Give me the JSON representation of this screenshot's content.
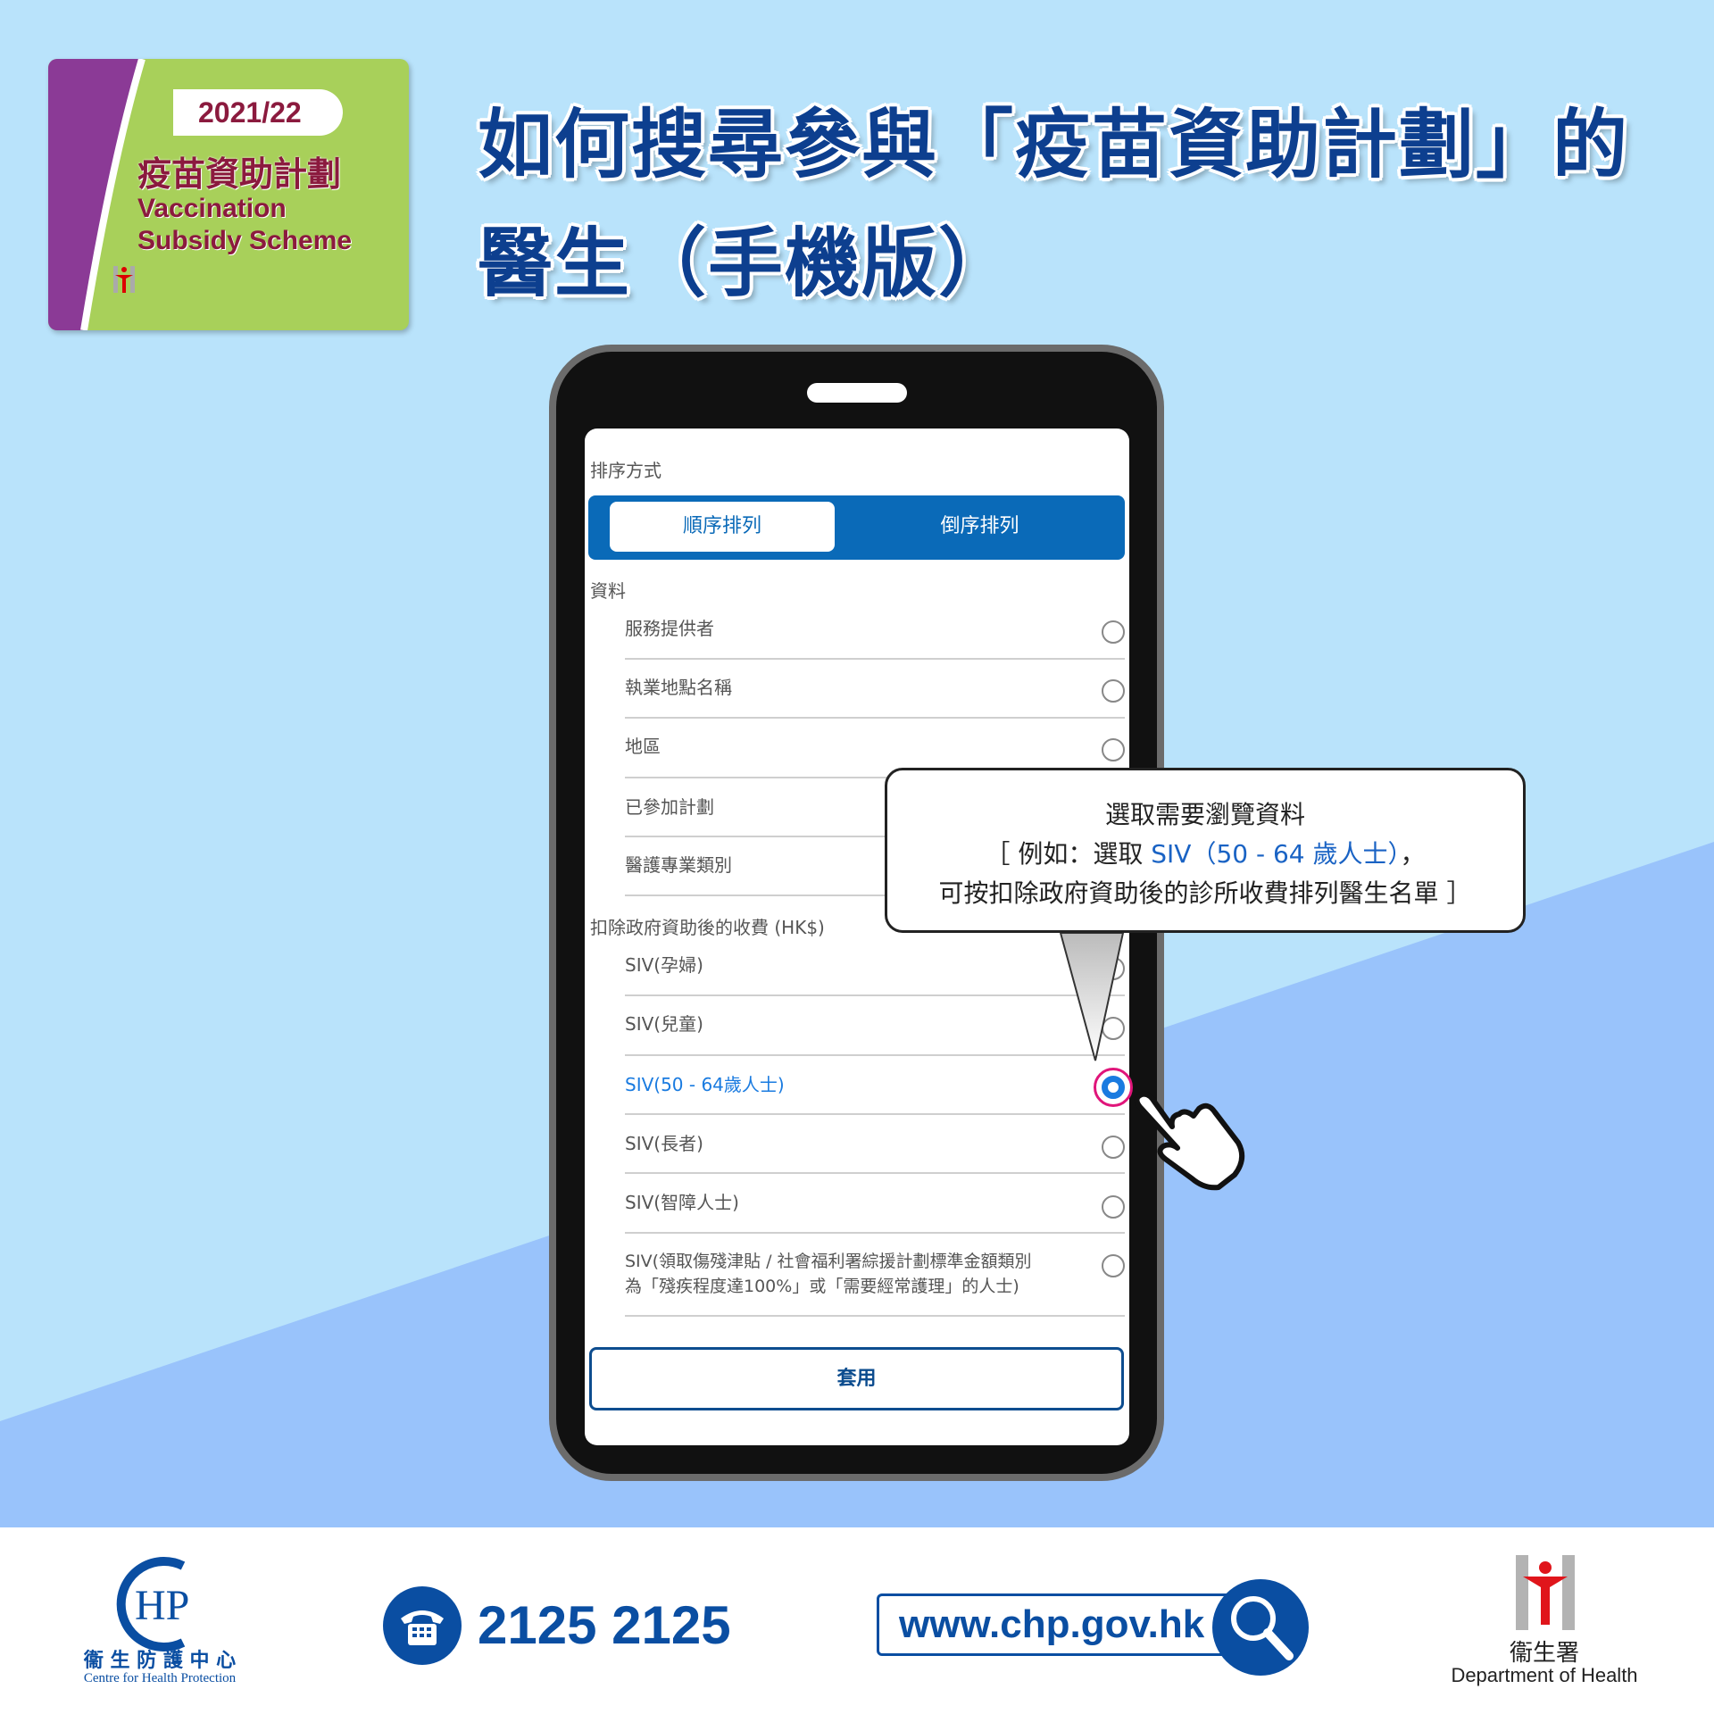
{
  "badge": {
    "year": "2021/22",
    "title_zh": "疫苗資助計劃",
    "title_en_1": "Vaccination",
    "title_en_2": "Subsidy Scheme",
    "logo_text": "衞生署 Department of Health"
  },
  "title": {
    "line1": "如何搜尋參與「疫苗資助計劃」的",
    "line2": "醫生（手機版）"
  },
  "screen": {
    "sort_label": "排序方式",
    "sort_options": [
      {
        "label": "順序排列",
        "selected": true
      },
      {
        "label": "倒序排列",
        "selected": false
      }
    ],
    "info_label": "資料",
    "info_items": [
      {
        "label": "服務提供者"
      },
      {
        "label": "執業地點名稱"
      },
      {
        "label": "地區"
      },
      {
        "label": "已參加計劃"
      },
      {
        "label": "醫護專業類別"
      }
    ],
    "fee_label": "扣除政府資助後的收費 (HK$)",
    "fee_items": [
      {
        "label": "SIV(孕婦)",
        "selected": false
      },
      {
        "label": "SIV(兒童)",
        "selected": false
      },
      {
        "label": "SIV(50 - 64歲人士)",
        "selected": true
      },
      {
        "label": "SIV(長者)",
        "selected": false
      },
      {
        "label": "SIV(智障人士)",
        "selected": false
      },
      {
        "label": "SIV(領取傷殘津貼 / 社會福利署綜援計劃標準金額類別",
        "label2": "為「殘疾程度達100%」或「需要經常護理」的人士)",
        "selected": false
      }
    ],
    "apply_label": "套用"
  },
  "callout": {
    "line1": "選取需要瀏覽資料",
    "line2_a": "［ 例如：選取 ",
    "line2_b": "SIV（50 - 64 歲人士）",
    "line2_c": "，",
    "line3": "可按扣除政府資助後的診所收費排列醫生名單 ］"
  },
  "footer": {
    "chp_logo": "CHP",
    "chp_zh": "衞 生 防 護 中 心",
    "chp_en": "Centre for Health Protection",
    "phone": "2125 2125",
    "url": "www.chp.gov.hk",
    "doh_zh": "衞生署",
    "doh_en": "Department of Health"
  },
  "colors": {
    "accent": "#0a6ab8",
    "title": "#0d3f8f",
    "badge_green": "#a8d05a",
    "badge_purple": "#8b3a96",
    "highlight": "#e0157a"
  }
}
